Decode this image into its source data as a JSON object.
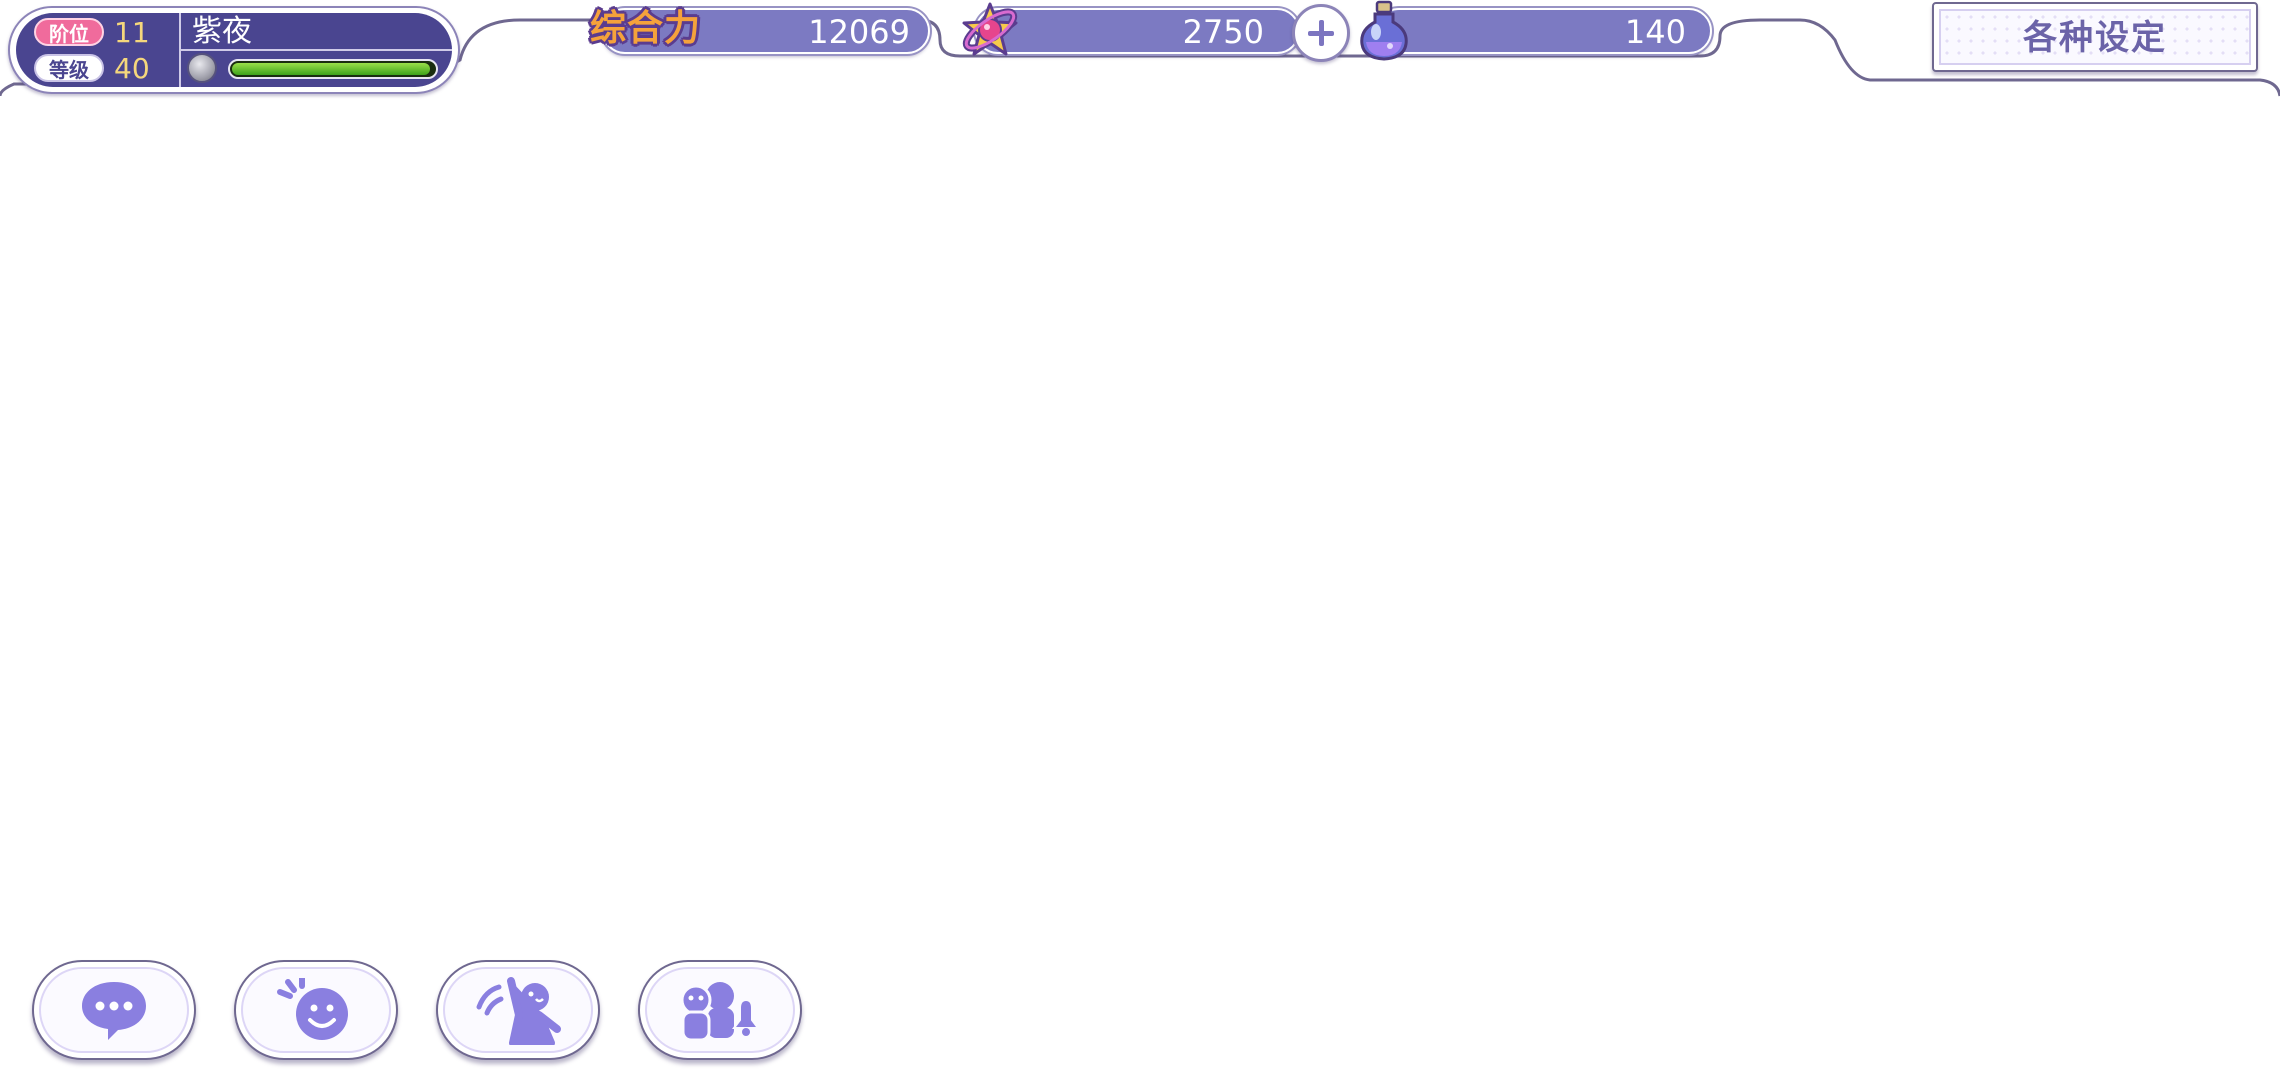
{
  "player": {
    "rank_label": "阶位",
    "rank_value": "11",
    "level_label": "等级",
    "level_value": "40",
    "name": "紫夜",
    "exp_progress": 0.98
  },
  "resources": {
    "power_label": "综合力",
    "power_value": "12069",
    "stars_value": "2750",
    "potion_value": "140"
  },
  "settings": {
    "label": "各种设定"
  },
  "actions": [
    {
      "name": "chat",
      "icon": "chat-bubble-icon"
    },
    {
      "name": "emote",
      "icon": "smiley-face-icon"
    },
    {
      "name": "cheer",
      "icon": "cheering-person-icon"
    },
    {
      "name": "notify",
      "icon": "people-bell-icon"
    }
  ],
  "colors": {
    "panel_bg": "#4a4590",
    "bar_bg": "#7c7ac2",
    "icon": "#8a7fe0",
    "exp_fill": "#3da21a",
    "rank_tag": "#f06b9c",
    "stat_value": "#f5d77c"
  }
}
